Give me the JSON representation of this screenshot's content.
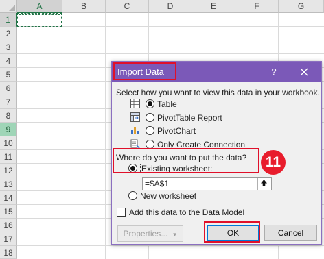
{
  "sheet": {
    "columns": [
      "A",
      "B",
      "C",
      "D",
      "E",
      "F",
      "G"
    ],
    "rows": [
      "1",
      "2",
      "3",
      "4",
      "5",
      "6",
      "7",
      "8",
      "9",
      "10",
      "11",
      "12",
      "13",
      "14",
      "15",
      "16",
      "17",
      "18"
    ],
    "active_column": "A",
    "active_row": "1",
    "highlighted_row": "9"
  },
  "dialog": {
    "title": "Import Data",
    "help_label": "?",
    "prompt_view": "Select how you want to view this data in your workbook.",
    "view_options": [
      {
        "label": "Table",
        "selected": true,
        "icon": "table-icon"
      },
      {
        "label": "PivotTable Report",
        "selected": false,
        "icon": "pivottable-icon"
      },
      {
        "label": "PivotChart",
        "selected": false,
        "icon": "pivotchart-icon"
      },
      {
        "label": "Only Create Connection",
        "selected": false,
        "icon": "connection-icon"
      }
    ],
    "prompt_location": "Where do you want to put the data?",
    "location_options": [
      {
        "label": "Existing worksheet:",
        "selected": true
      },
      {
        "label": "New worksheet",
        "selected": false
      }
    ],
    "cell_reference": "=$A$1",
    "data_model_label": "Add this data to the Data Model",
    "data_model_checked": false,
    "properties_label": "Properties...",
    "ok_label": "OK",
    "cancel_label": "Cancel"
  },
  "annotation": {
    "step_badge": "11",
    "highlight_color": "#e0102a"
  },
  "colors": {
    "titlebar": "#7b59b8",
    "excel_green": "#217346"
  }
}
